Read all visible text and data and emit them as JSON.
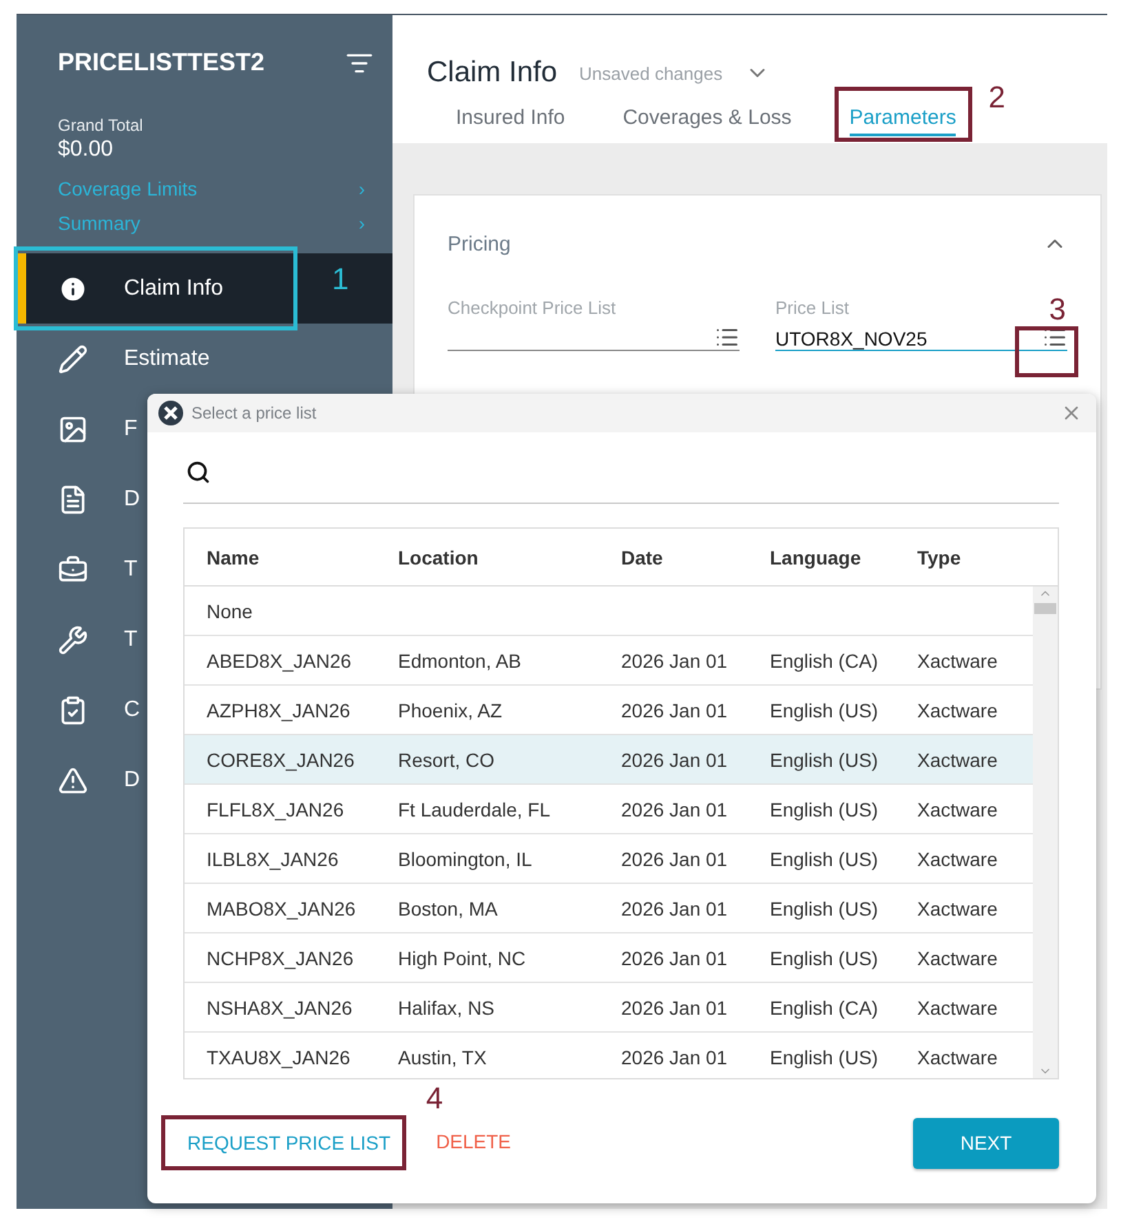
{
  "sidebar": {
    "title": "PRICELISTTEST2",
    "grand_total_label": "Grand Total",
    "grand_total": "$0.00",
    "links": [
      {
        "label": "Coverage Limits",
        "chevron": "›"
      },
      {
        "label": "Summary",
        "chevron": "›"
      }
    ],
    "items": [
      {
        "label": "Claim Info",
        "selected": true,
        "callout": {
          "number": "1",
          "color": "#2bbcd4"
        }
      },
      {
        "label": "Estimate",
        "selected": false
      },
      {
        "label": "F",
        "selected": false
      },
      {
        "label": "D",
        "selected": false
      },
      {
        "label": "T",
        "selected": false
      },
      {
        "label": "T",
        "selected": false
      },
      {
        "label": "C",
        "selected": false
      },
      {
        "label": "D",
        "selected": false
      }
    ]
  },
  "header": {
    "title": "Claim Info",
    "status": "Unsaved changes",
    "tabs": [
      {
        "label": "Insured Info",
        "selected": false
      },
      {
        "label": "Coverages & Loss",
        "selected": false
      },
      {
        "label": "Parameters",
        "selected": true,
        "callout": {
          "number": "2",
          "color": "#7a2335"
        }
      }
    ]
  },
  "pricing": {
    "title": "Pricing",
    "expanded": true,
    "fields": [
      {
        "label": "Checkpoint Price List",
        "active": false
      },
      {
        "label": "Price List",
        "value": "UTOR8X_NOV25",
        "active": true,
        "callout": {
          "number": "3",
          "color": "#7a2335"
        }
      }
    ]
  },
  "dialog": {
    "title": "Select a price list",
    "columns": [
      "Name",
      "Location",
      "Date",
      "Language",
      "Type"
    ],
    "rows": [
      {
        "cells": [
          "None"
        ],
        "selected": false
      },
      {
        "cells": [
          "ABED8X_JAN26",
          "Edmonton, AB",
          "2026 Jan 01",
          "English (CA)",
          "Xactware"
        ],
        "selected": false
      },
      {
        "cells": [
          "AZPH8X_JAN26",
          "Phoenix, AZ",
          "2026 Jan 01",
          "English (US)",
          "Xactware"
        ],
        "selected": false
      },
      {
        "cells": [
          "CORE8X_JAN26",
          "Resort, CO",
          "2026 Jan 01",
          "English (US)",
          "Xactware"
        ],
        "selected": true
      },
      {
        "cells": [
          "FLFL8X_JAN26",
          "Ft Lauderdale, FL",
          "2026 Jan 01",
          "English (US)",
          "Xactware"
        ],
        "selected": false
      },
      {
        "cells": [
          "ILBL8X_JAN26",
          "Bloomington, IL",
          "2026 Jan 01",
          "English (US)",
          "Xactware"
        ],
        "selected": false
      },
      {
        "cells": [
          "MABO8X_JAN26",
          "Boston, MA",
          "2026 Jan 01",
          "English (US)",
          "Xactware"
        ],
        "selected": false
      },
      {
        "cells": [
          "NCHP8X_JAN26",
          "High Point, NC",
          "2026 Jan 01",
          "English (US)",
          "Xactware"
        ],
        "selected": false
      },
      {
        "cells": [
          "NSHA8X_JAN26",
          "Halifax, NS",
          "2026 Jan 01",
          "English (CA)",
          "Xactware"
        ],
        "selected": false
      },
      {
        "cells": [
          "TXAU8X_JAN26",
          "Austin, TX",
          "2026 Jan 01",
          "English (US)",
          "Xactware"
        ],
        "selected": false
      }
    ],
    "buttons": [
      {
        "kind": "link",
        "label": "REQUEST PRICE LIST",
        "callout": {
          "number": "4",
          "color": "#7a2335"
        }
      },
      {
        "kind": "danger",
        "label": "DELETE"
      },
      {
        "kind": "primary",
        "label": "NEXT"
      }
    ]
  }
}
